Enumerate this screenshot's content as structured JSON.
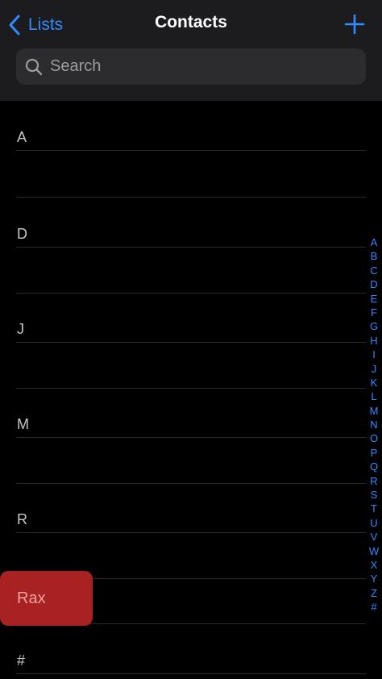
{
  "nav": {
    "back_label": "Lists",
    "title": "Contacts"
  },
  "search": {
    "placeholder": "Search",
    "value": ""
  },
  "sections": [
    {
      "letter": "A"
    },
    {
      "letter": "D"
    },
    {
      "letter": "J"
    },
    {
      "letter": "M"
    },
    {
      "letter": "R"
    },
    {
      "letter": ""
    },
    {
      "letter": "#"
    }
  ],
  "index": [
    "A",
    "B",
    "C",
    "D",
    "E",
    "F",
    "G",
    "H",
    "I",
    "J",
    "K",
    "L",
    "M",
    "N",
    "O",
    "P",
    "Q",
    "R",
    "S",
    "T",
    "U",
    "V",
    "W",
    "X",
    "Y",
    "Z",
    "#"
  ],
  "drag_tile": {
    "label": "Rax"
  },
  "colors": {
    "accent": "#2f8bff",
    "background": "#000000",
    "header": "#1c1c1e",
    "search_field": "#2c2c2e",
    "drag_tile": "#a82222"
  },
  "icons": {
    "back": "chevron-left-icon",
    "add": "plus-icon",
    "search": "search-icon"
  }
}
